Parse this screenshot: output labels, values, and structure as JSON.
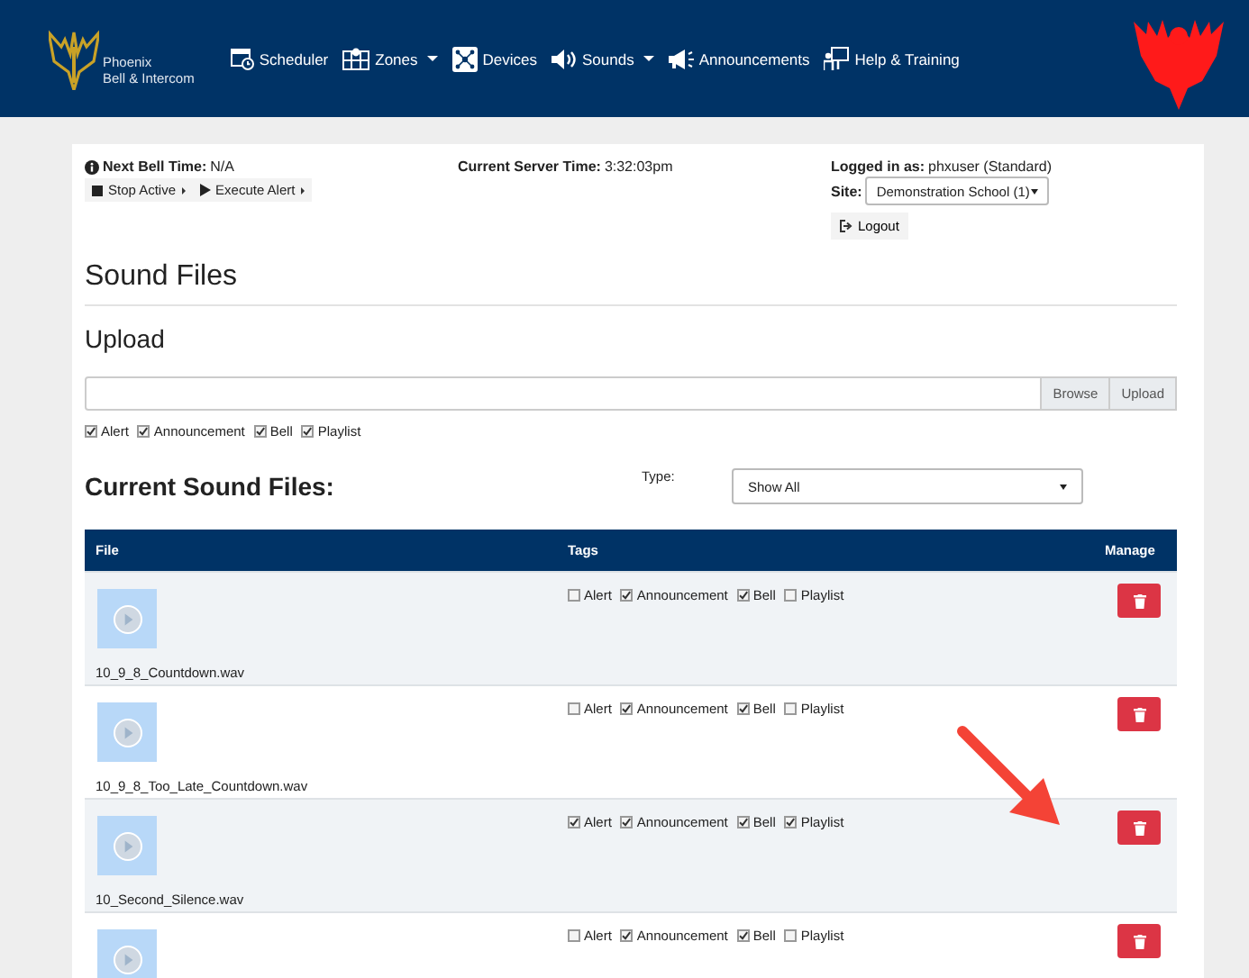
{
  "nav": {
    "brand": [
      "Phoenix",
      "Bell & Intercom"
    ],
    "items": [
      {
        "kind": "scheduler",
        "label": "Scheduler",
        "dropdown": false
      },
      {
        "kind": "zones",
        "label": "Zones",
        "dropdown": true
      },
      {
        "kind": "devices",
        "label": "Devices",
        "dropdown": false
      },
      {
        "kind": "sounds",
        "label": "Sounds",
        "dropdown": true
      },
      {
        "kind": "announcements",
        "label": "Announcements",
        "dropdown": false
      },
      {
        "kind": "help",
        "label": "Help & Training",
        "dropdown": false
      }
    ]
  },
  "info": {
    "next_bell_label": "Next Bell Time:",
    "next_bell_value": "N/A",
    "buttons": [
      {
        "kind": "stop",
        "label": "Stop Active"
      },
      {
        "kind": "play",
        "label": "Execute Alert"
      }
    ],
    "server_time_label": "Current Server Time:",
    "server_time_value": "3:32:03pm",
    "logged_in_label": "Logged in as:",
    "logged_in_value": "phxuser (Standard)",
    "site_label": "Site:",
    "site_value": "Demonstration School (1)",
    "logout": "Logout"
  },
  "page_title": "Sound Files",
  "upload": {
    "title": "Upload",
    "browse": "Browse",
    "upload": "Upload",
    "tags": [
      {
        "label": "Alert",
        "checked": true
      },
      {
        "label": "Announcement",
        "checked": true
      },
      {
        "label": "Bell",
        "checked": true
      },
      {
        "label": "Playlist",
        "checked": true
      }
    ]
  },
  "files": {
    "title": "Current Sound Files:",
    "type_label": "Type:",
    "type_value": "Show All",
    "columns": [
      "File",
      "Tags",
      "Manage"
    ],
    "rows": [
      {
        "name": "10_9_8_Countdown.wav",
        "tags": [
          {
            "label": "Alert",
            "checked": false
          },
          {
            "label": "Announcement",
            "checked": true
          },
          {
            "label": "Bell",
            "checked": true
          },
          {
            "label": "Playlist",
            "checked": false
          }
        ]
      },
      {
        "name": "10_9_8_Too_Late_Countdown.wav",
        "tags": [
          {
            "label": "Alert",
            "checked": false
          },
          {
            "label": "Announcement",
            "checked": true
          },
          {
            "label": "Bell",
            "checked": true
          },
          {
            "label": "Playlist",
            "checked": false
          }
        ]
      },
      {
        "name": "10_Second_Silence.wav",
        "tags": [
          {
            "label": "Alert",
            "checked": true
          },
          {
            "label": "Announcement",
            "checked": true
          },
          {
            "label": "Bell",
            "checked": true
          },
          {
            "label": "Playlist",
            "checked": true
          }
        ]
      },
      {
        "tags": [
          {
            "label": "Alert",
            "checked": false
          },
          {
            "label": "Announcement",
            "checked": true
          },
          {
            "label": "Bell",
            "checked": true
          },
          {
            "label": "Playlist",
            "checked": false
          }
        ]
      }
    ]
  }
}
